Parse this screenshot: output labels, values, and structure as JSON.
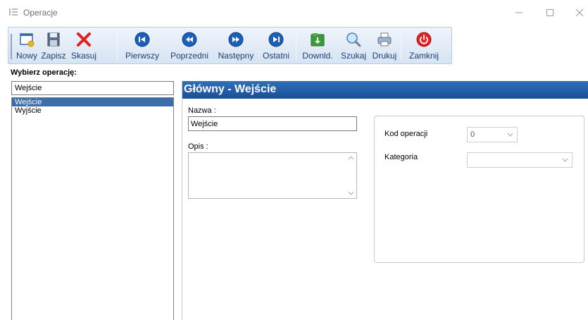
{
  "window": {
    "title": "Operacje"
  },
  "toolbar": {
    "buttons": [
      {
        "label": "Nowy",
        "icon": "new-document-icon"
      },
      {
        "label": "Zapisz",
        "icon": "save-icon"
      },
      {
        "label": "Skasuj",
        "icon": "delete-x-icon"
      },
      {
        "label": "Pierwszy",
        "icon": "first-record-icon"
      },
      {
        "label": "Poprzedni",
        "icon": "previous-record-icon"
      },
      {
        "label": "Następny",
        "icon": "next-record-icon"
      },
      {
        "label": "Ostatni",
        "icon": "last-record-icon"
      },
      {
        "label": "Downld.",
        "icon": "download-icon"
      },
      {
        "label": "Szukaj",
        "icon": "search-icon"
      },
      {
        "label": "Drukuj",
        "icon": "print-icon"
      },
      {
        "label": "Zamknij",
        "icon": "power-close-icon"
      }
    ]
  },
  "left": {
    "label": "Wybierz operację:",
    "search_value": "Wejście",
    "items": [
      "Wejście",
      "Wyjście"
    ],
    "selected_index": 0
  },
  "main": {
    "header": "Główny - Wejście",
    "nazwa_label": "Nazwa :",
    "nazwa_value": "Wejście",
    "opis_label": "Opis :",
    "opis_value": "",
    "kod_label": "Kod operacji",
    "kod_value": "0",
    "kategoria_label": "Kategoria",
    "kategoria_value": ""
  },
  "colors": {
    "header_blue": "#1f5aa3",
    "selection_blue": "#3a6ea8",
    "toolbar_text": "#1d3f74"
  }
}
